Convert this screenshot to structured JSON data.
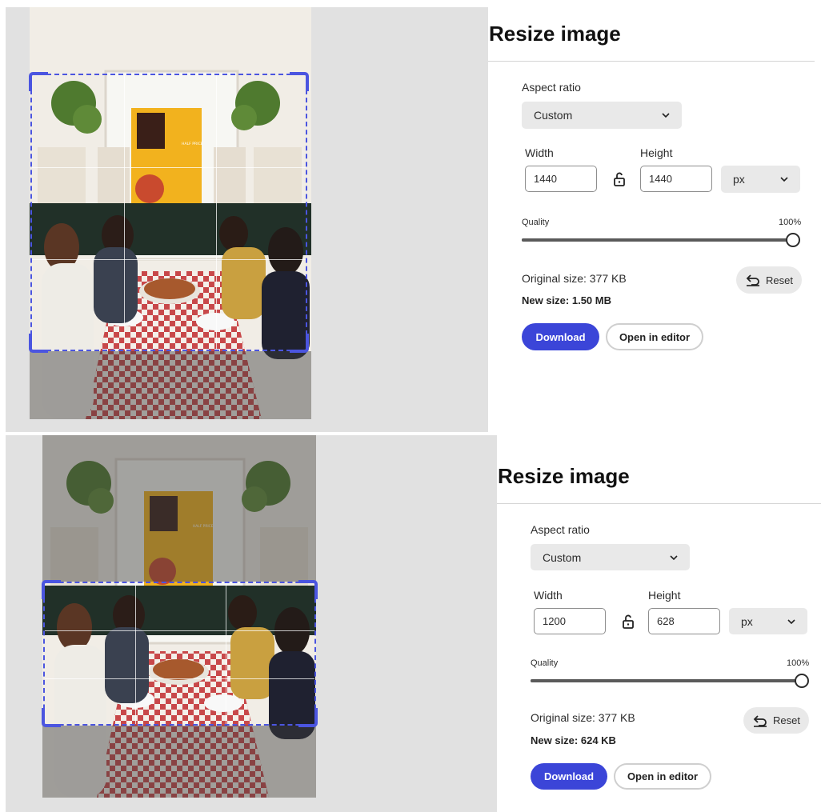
{
  "states": [
    {
      "title": "Resize image",
      "aspect_ratio_label": "Aspect ratio",
      "aspect_ratio_value": "Custom",
      "width_label": "Width",
      "height_label": "Height",
      "width_value": "1440",
      "height_value": "1440",
      "unit_value": "px",
      "quality_label": "Quality",
      "quality_value": "100%",
      "quality_fraction": 1.0,
      "original_size": "Original size:  377 KB",
      "new_size": "New size:  1.50 MB",
      "reset_label": "Reset",
      "download_label": "Download",
      "open_editor_label": "Open in editor"
    },
    {
      "title": "Resize image",
      "aspect_ratio_label": "Aspect ratio",
      "aspect_ratio_value": "Custom",
      "width_label": "Width",
      "height_label": "Height",
      "width_value": "1200",
      "height_value": "628",
      "unit_value": "px",
      "quality_label": "Quality",
      "quality_value": "100%",
      "quality_fraction": 1.0,
      "original_size": "Original size:  377 KB",
      "new_size": "New size:  624 KB",
      "reset_label": "Reset",
      "download_label": "Download",
      "open_editor_label": "Open in editor"
    }
  ],
  "poster_text": [
    "HALF PRICE",
    "BOTTLES OF WINE",
    "WITH ANY LARGE",
    "OR X-LARGE",
    "SPECIALTY",
    "PIZZA",
    "PIZZA"
  ],
  "icons": {
    "lock": "unlock-icon",
    "chevron": "chevron-down-icon",
    "reset": "undo-icon"
  },
  "colors": {
    "accent": "#3b45d8",
    "crop_outline": "#4b55e0",
    "canvas_bg": "#e1e1e1"
  }
}
